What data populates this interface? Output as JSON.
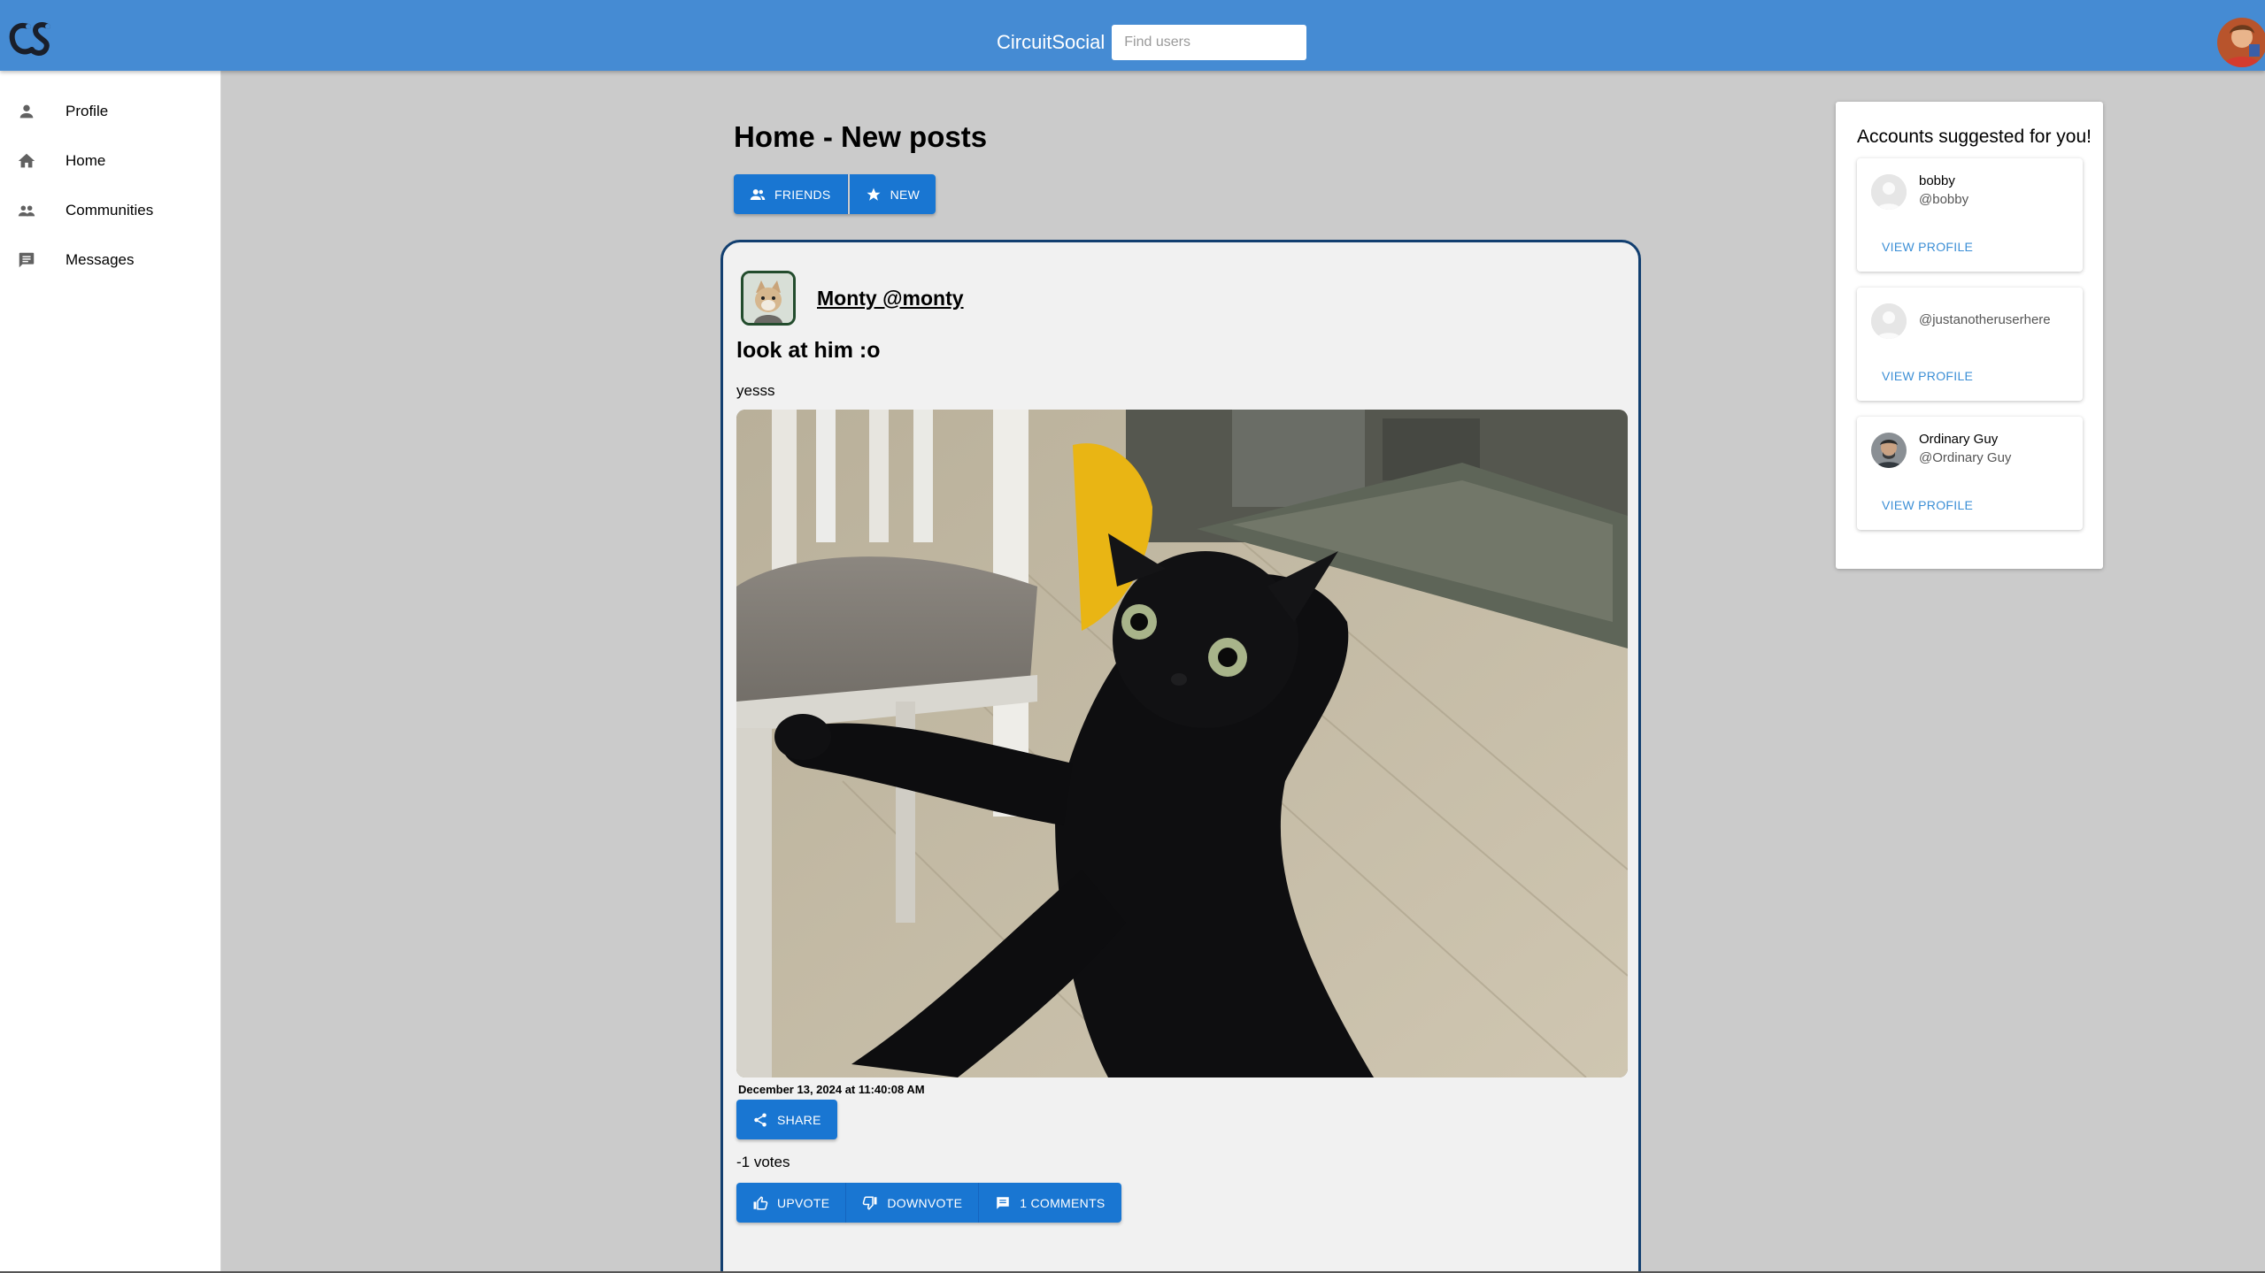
{
  "app": {
    "brand": "CircuitSocial",
    "search_placeholder": "Find users",
    "colors": {
      "topbar": "#458bd3",
      "accent": "#1976d2",
      "card_border": "#123f70",
      "link": "#3c8fd6"
    }
  },
  "sidebar": {
    "items": [
      {
        "label": "Profile",
        "icon": "person-icon"
      },
      {
        "label": "Home",
        "icon": "home-icon"
      },
      {
        "label": "Communities",
        "icon": "group-icon"
      },
      {
        "label": "Messages",
        "icon": "chat-icon"
      }
    ]
  },
  "main": {
    "title": "Home - New posts",
    "tabs": [
      {
        "label": "Friends",
        "icon": "people-icon"
      },
      {
        "label": "New",
        "icon": "star-icon"
      }
    ]
  },
  "post": {
    "author": "Monty @monty",
    "title": "look at him :o",
    "body": "yesss",
    "date": "December 13, 2024 at 11:40:08 AM",
    "share_label": "Share",
    "votes_text": "-1 votes",
    "upvote_label": "Upvote",
    "downvote_label": "Downvote",
    "comments_label": "1 Comments"
  },
  "suggestions": {
    "title": "Accounts suggested for you!",
    "view_label": "View Profile",
    "accounts": [
      {
        "name": "bobby",
        "handle": "@bobby"
      },
      {
        "name": "",
        "handle": "@justanotheruserhere"
      },
      {
        "name": "Ordinary Guy",
        "handle": "@Ordinary Guy"
      }
    ]
  }
}
